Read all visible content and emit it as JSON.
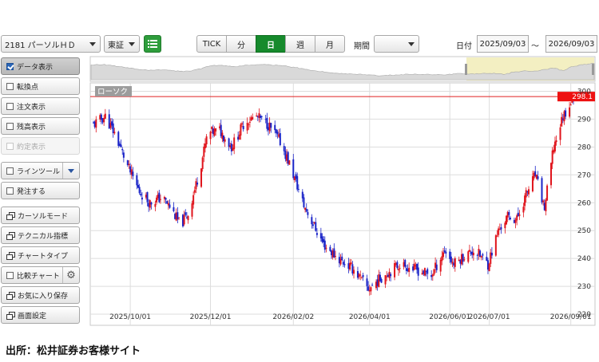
{
  "toolbar": {
    "stock_select": "2181 パーソルＨＤ",
    "market_select": "東証",
    "timeframe_tabs": [
      {
        "label": "TICK",
        "active": false
      },
      {
        "label": "分",
        "active": false
      },
      {
        "label": "日",
        "active": true
      },
      {
        "label": "週",
        "active": false
      },
      {
        "label": "月",
        "active": false
      }
    ],
    "period_label": "期間",
    "period_value": "",
    "date_label": "日付",
    "date_from": "2025/09/03",
    "date_separator": "～",
    "date_to": "2026/09/03"
  },
  "sidebar": {
    "items": [
      {
        "label": "データ表示",
        "control": "checkbox",
        "checked": true,
        "active": true
      },
      {
        "label": "転換点",
        "control": "checkbox",
        "checked": false
      },
      {
        "label": "注文表示",
        "control": "checkbox",
        "checked": false
      },
      {
        "label": "残高表示",
        "control": "checkbox",
        "checked": false
      },
      {
        "label": "約定表示",
        "control": "checkbox",
        "checked": false,
        "disabled": true
      },
      {
        "label": "ラインツール",
        "control": "checkbox",
        "checked": false,
        "has_dropdown": true
      },
      {
        "label": "発注する",
        "control": "checkbox",
        "checked": false
      },
      {
        "label": "カーソルモード",
        "control": "window-icon"
      },
      {
        "label": "テクニカル指標",
        "control": "window-icon"
      },
      {
        "label": "チャートタイプ",
        "control": "window-icon"
      },
      {
        "label": "比較チャート",
        "control": "checkbox",
        "checked": false,
        "has_gear": true
      },
      {
        "label": "お気に入り保存",
        "control": "window-icon"
      },
      {
        "label": "画面設定",
        "control": "window-icon"
      }
    ]
  },
  "colors": {
    "up": "#e0141c",
    "down": "#1a24c8",
    "accent_green": "#168a2c",
    "price_line": "#e02020",
    "navigator_highlight": "#f3efc2"
  },
  "chart_data": {
    "type": "candlestick",
    "chart_type_label": "ローソク",
    "current_price": "298.1",
    "ylim": [
      216,
      303
    ],
    "y_ticks": [
      220,
      230,
      240,
      250,
      260,
      270,
      280,
      290,
      300
    ],
    "y_tick_labels": [
      "220",
      "230",
      "240",
      "250",
      "260",
      "270",
      "280",
      "290",
      "300"
    ],
    "x_tick_labels": [
      "2025/10/01",
      "2025/12/01",
      "2026/02/02",
      "2026/04/01",
      "2026/06/01",
      "2026/07/01",
      "2026/09/01"
    ],
    "x_tick_dates": [
      "2025-10-01",
      "2025-12-01",
      "2026-02-02",
      "2026-04-01",
      "2026-06-01",
      "2026-07-01",
      "2026-09-01"
    ],
    "x_range": [
      "2025-09-03",
      "2026-09-03"
    ],
    "path_dates": [
      "2025-09-03",
      "2025-09-12",
      "2025-09-20",
      "2025-09-30",
      "2025-10-08",
      "2025-10-16",
      "2025-10-25",
      "2025-11-01",
      "2025-11-08",
      "2025-11-14",
      "2025-11-22",
      "2025-11-29",
      "2025-12-08",
      "2025-12-17",
      "2025-12-27",
      "2026-01-05",
      "2026-01-14",
      "2026-01-23",
      "2026-01-30",
      "2026-02-05",
      "2026-02-10",
      "2026-02-25",
      "2026-03-08",
      "2026-03-20",
      "2026-03-31",
      "2026-04-12",
      "2026-04-24",
      "2026-05-06",
      "2026-05-18",
      "2026-05-28",
      "2026-06-04",
      "2026-06-12",
      "2026-06-20",
      "2026-06-30",
      "2026-07-08",
      "2026-07-15",
      "2026-07-22",
      "2026-07-29",
      "2026-08-05",
      "2026-08-12",
      "2026-08-19",
      "2026-08-26",
      "2026-09-03"
    ],
    "path_closes": [
      288,
      291,
      284,
      272,
      264,
      260,
      262,
      258,
      252,
      256,
      270,
      285,
      286,
      280,
      289,
      291,
      288,
      282,
      274,
      266,
      259,
      245,
      240,
      236,
      229,
      234,
      238,
      236,
      234,
      243,
      238,
      241,
      243,
      238,
      250,
      255,
      254,
      263,
      270,
      258,
      280,
      291,
      298
    ]
  }
}
